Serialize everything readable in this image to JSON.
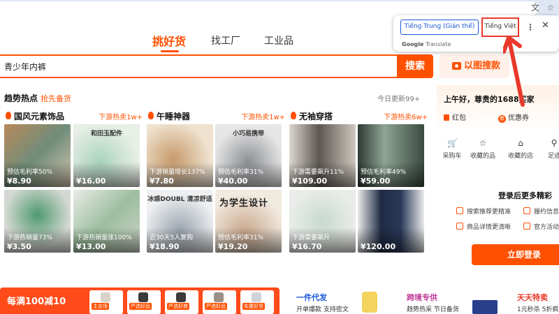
{
  "browser": {
    "translate_icon": "translate-icon",
    "star_icon": "star-icon"
  },
  "nav": {
    "tabs": [
      "挑好货",
      "找工厂",
      "工业品"
    ],
    "active_index": 0
  },
  "search": {
    "value": "青少年内裤",
    "button_label": "搜索",
    "image_search_label": "以图搜款"
  },
  "trend": {
    "title": "趋势热点",
    "subtitle": "抢先备货",
    "updated": "今日更新99+",
    "categories": [
      {
        "name": "国风元素饰品",
        "hot": "下游热卖1w+",
        "items": [
          {
            "tag": "预估毛利率50%",
            "price": "¥8.90",
            "overlay": ""
          },
          {
            "tag": "",
            "price": "¥16.00",
            "overlay": "和田玉配件"
          },
          {
            "tag": "下游热销量73%",
            "price": "¥3.50",
            "overlay": ""
          },
          {
            "tag": "下游热销量涨100%",
            "price": "¥13.00",
            "overlay": ""
          }
        ]
      },
      {
        "name": "午睡神器",
        "hot": "下游热卖1w+",
        "items": [
          {
            "tag": "下游销量增长137%",
            "price": "¥7.80",
            "overlay": ""
          },
          {
            "tag": "预估毛利率31%",
            "price": "¥40.00",
            "overlay": "小巧易携带"
          },
          {
            "tag": "近30天5人复购",
            "price": "¥18.90",
            "overlay": "冰感DOUBL 清凉舒适"
          },
          {
            "tag": "预估毛利率31%",
            "price": "¥19.20",
            "overlay": "为学生设计"
          }
        ]
      },
      {
        "name": "无袖穿搭",
        "hot": "下游热卖6w+",
        "items": [
          {
            "tag": "下游需要飙升11%",
            "price": "¥109.00",
            "overlay": ""
          },
          {
            "tag": "预估毛利率49%",
            "price": "¥59.00",
            "overlay": ""
          },
          {
            "tag": "下游需要飙升",
            "price": "¥16.70",
            "overlay": ""
          },
          {
            "tag": "",
            "price": "¥120.00",
            "overlay": ""
          }
        ]
      }
    ]
  },
  "user": {
    "greeting": "上午好，尊贵的1688买家",
    "hongbao": "红包",
    "coupon": "优惠券",
    "quick_links": [
      "采购车",
      "收藏的品",
      "收藏的店",
      "足迹"
    ],
    "login_more": "登录后更多精彩",
    "benefits": [
      "搜索推荐更精准",
      "履约信息",
      "商品详情更清晰",
      "官方活动"
    ],
    "login_button": "立即登录"
  },
  "bottom": {
    "promo": "每满100减10",
    "promo_cards": [
      "主会场",
      "严选好品",
      "严选好商",
      "严选好品",
      "实惠好货"
    ],
    "sections": [
      {
        "title": "一件代发",
        "sub": "开单爆款 支持密文",
        "color": "#1a57d6"
      },
      {
        "title": "跨境专供",
        "sub": "趋势热采 节日备货",
        "color": "#c0399a"
      },
      {
        "title": "天天特卖",
        "sub": "1元秒杀 5折疯抢",
        "color": "#e8392b"
      }
    ]
  },
  "translate": {
    "source_lang": "Tiếng Trung (Giản thể)",
    "target_lang": "Tiếng Việt",
    "footer_brand": "Google",
    "footer_product": "Translate"
  }
}
